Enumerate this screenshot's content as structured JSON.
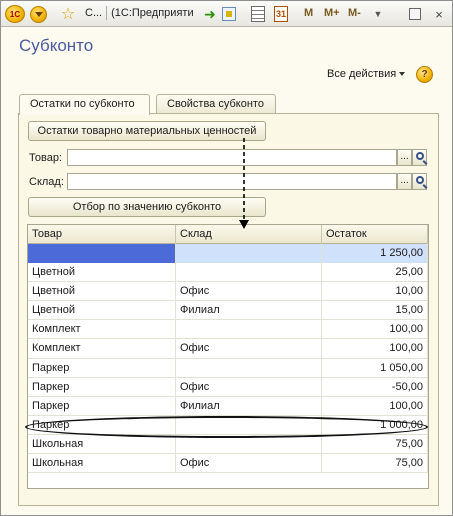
{
  "titlebar": {
    "logo_text": "1С",
    "tab_short": "С...",
    "tab_title": "(1С:Предприяти",
    "m_label": "M",
    "m_plus_label": "M+",
    "m_minus_label": "M-",
    "calendar_text": "31",
    "close_glyph": "×"
  },
  "form": {
    "title": "Субконто",
    "all_actions": "Все действия",
    "help": "?"
  },
  "tabs": [
    {
      "label": "Остатки по субконто",
      "active": true
    },
    {
      "label": "Свойства субконто",
      "active": false
    }
  ],
  "panel": {
    "remains_button": "Остатки товарно материальных ценностей",
    "goods_label": "Товар:",
    "goods_value": "",
    "warehouse_label": "Склад:",
    "warehouse_value": "",
    "dots": "...",
    "filter_button": "Отбор по значению субконто"
  },
  "table": {
    "columns": [
      "Товар",
      "Склад",
      "Остаток"
    ],
    "rows": [
      {
        "goods": "",
        "warehouse": "",
        "remainder": "1 250,00",
        "selected": true
      },
      {
        "goods": "Цветной",
        "warehouse": "",
        "remainder": "25,00"
      },
      {
        "goods": "Цветной",
        "warehouse": "Офис",
        "remainder": "10,00"
      },
      {
        "goods": "Цветной",
        "warehouse": "Филиал",
        "remainder": "15,00"
      },
      {
        "goods": "Комплект",
        "warehouse": "",
        "remainder": "100,00"
      },
      {
        "goods": "Комплект",
        "warehouse": "Офис",
        "remainder": "100,00"
      },
      {
        "goods": "Паркер",
        "warehouse": "",
        "remainder": "1 050,00"
      },
      {
        "goods": "Паркер",
        "warehouse": "Офис",
        "remainder": "-50,00"
      },
      {
        "goods": "Паркер",
        "warehouse": "Филиал",
        "remainder": "100,00"
      },
      {
        "goods": "Паркер",
        "warehouse": "",
        "remainder": "1 000,00",
        "highlighted": true
      },
      {
        "goods": "Школьная",
        "warehouse": "",
        "remainder": "75,00"
      },
      {
        "goods": "Школьная",
        "warehouse": "Офис",
        "remainder": "75,00"
      }
    ]
  },
  "colors": {
    "title": "#4c5a9e",
    "selection_dark": "#4c6ad8",
    "selection_light": "#cfe1fb",
    "panel_bg": "#fbf8e5"
  }
}
